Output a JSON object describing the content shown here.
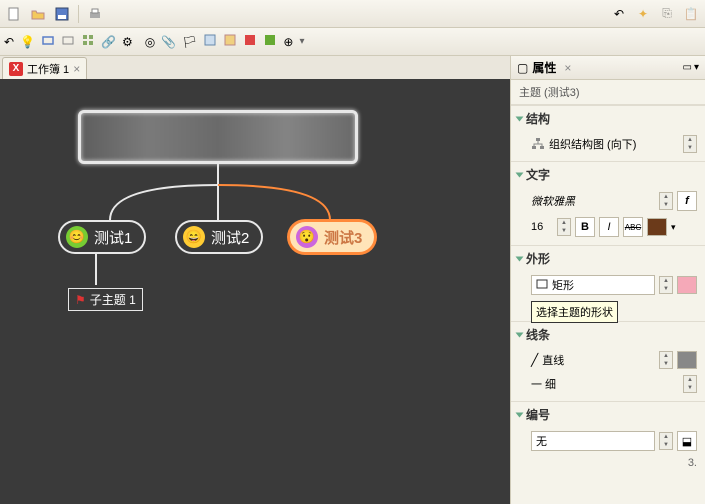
{
  "tab": {
    "label": "工作簿 1"
  },
  "canvas": {
    "node1": "测试1",
    "node2": "测试2",
    "node3": "测试3",
    "sub1": "子主题 1"
  },
  "panel": {
    "title": "属性",
    "subtitle": "主题 (测试3)",
    "sections": {
      "structure": {
        "label": "结构",
        "value": "组织结构图 (向下)"
      },
      "text": {
        "label": "文字",
        "font": "微软雅黑",
        "size": "16",
        "bold": "B",
        "italic": "I",
        "strike": "ABC"
      },
      "shape": {
        "label": "外形",
        "value": "矩形"
      },
      "line": {
        "label": "线条",
        "style": "直线",
        "weight": "一 细"
      },
      "number": {
        "label": "编号",
        "value": "无",
        "index": "3."
      }
    },
    "tooltip": "选择主题的形状"
  }
}
